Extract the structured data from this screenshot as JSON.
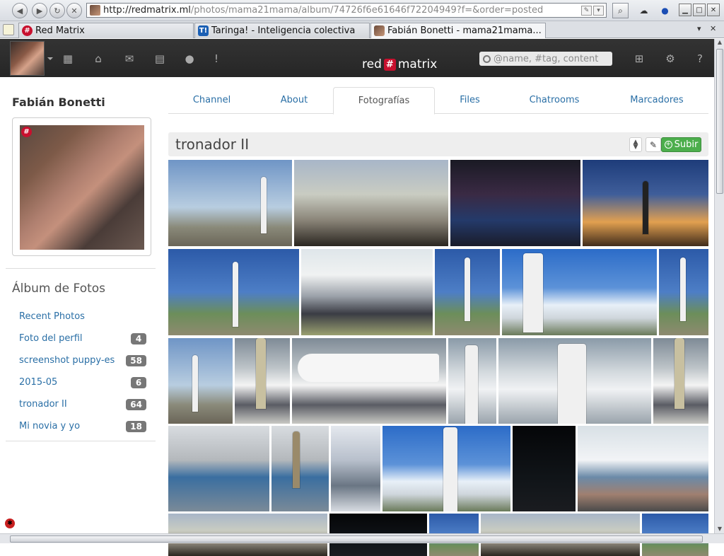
{
  "browser": {
    "url_host": "http://redmatrix.ml",
    "url_path": "/photos/mama21mama/album/74726f6e61646f72204949?f=&order=posted",
    "tabs": [
      {
        "label": "Red Matrix",
        "icon": "redmatrix-icon",
        "icon_glyph": "#"
      },
      {
        "label": "Taringa! - Inteligencia colectiva",
        "icon": "taringa-icon",
        "icon_glyph": "T!"
      },
      {
        "label": "Fabián Bonetti - mama21mama...",
        "icon": "photo-icon",
        "icon_glyph": ""
      }
    ]
  },
  "navbar": {
    "brand_left": "red",
    "brand_hash": "#",
    "brand_right": "matrix",
    "search_placeholder": "@name, #tag, content",
    "icons": [
      "apps-icon",
      "home-icon",
      "mail-icon",
      "calendar-icon",
      "user-icon",
      "alert-icon"
    ],
    "right_icons": [
      "sitemap-icon",
      "settings-icon",
      "help-icon"
    ]
  },
  "sidebar": {
    "owner_name": "Fabián Bonetti",
    "album_heading": "Álbum de Fotos",
    "albums": [
      {
        "label": "Recent Photos",
        "count": null
      },
      {
        "label": "Foto del perfil",
        "count": "4"
      },
      {
        "label": "screenshot puppy-es",
        "count": "58"
      },
      {
        "label": "2015-05",
        "count": "6"
      },
      {
        "label": "tronador II",
        "count": "64"
      },
      {
        "label": "Mi novia y yo",
        "count": "18"
      }
    ]
  },
  "profile_tabs": [
    "Channel",
    "About",
    "Fotografías",
    "Files",
    "Chatrooms",
    "Marcadores"
  ],
  "active_tab": "Fotografías",
  "album": {
    "title": "tronador II",
    "upload_label": "Subir"
  },
  "colors": {
    "navbar_bg": "#2b2b2b",
    "link": "#2a6fa6",
    "upload_green": "#4cae4c",
    "badge_gray": "#777777",
    "brand_red": "#c8102e"
  }
}
